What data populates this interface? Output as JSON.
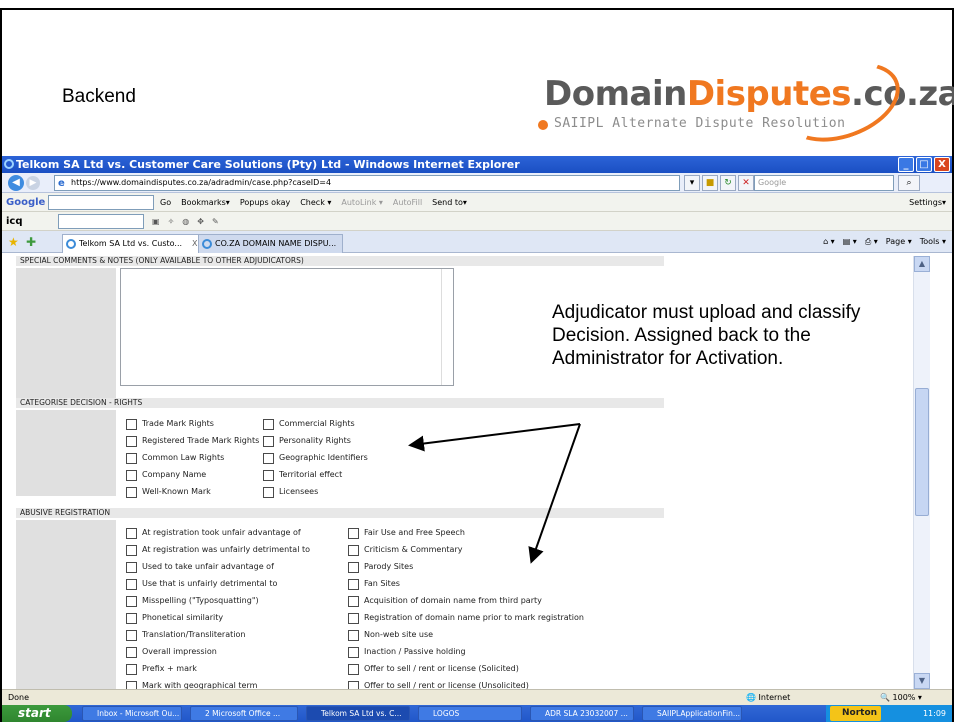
{
  "slide": {
    "title": "Backend",
    "logo": {
      "part1": "Domain",
      "part2": "Disputes",
      "part3": ".co.za",
      "subtitle": "SAIIPL Alternate Dispute Resolution"
    }
  },
  "window": {
    "title": "Telkom SA Ltd vs. Customer Care Solutions (Pty) Ltd - Windows Internet Explorer",
    "buttons": {
      "minimize": "_",
      "maximize": "□",
      "close": "X"
    }
  },
  "addressbar": {
    "url": "https://www.domaindisputes.co.za/adradmin/case.php?caseID=4",
    "search_placeholder": "Google"
  },
  "google_toolbar": {
    "label": "Google",
    "items": [
      "Go",
      "Bookmarks▾",
      "Popups okay",
      "Check ▾",
      "AutoLink ▾",
      "AutoFill",
      "Send to▾"
    ],
    "settings": "Settings▾"
  },
  "icq_toolbar": {
    "label": "icq"
  },
  "tabs": [
    {
      "label": "Telkom SA Ltd vs. Custo...",
      "close": "X",
      "active": true
    },
    {
      "label": "CO.ZA DOMAIN NAME DISPU...",
      "active": false
    }
  ],
  "tab_tools": {
    "page": "Page ▾",
    "tools": "Tools ▾"
  },
  "form": {
    "comments_header": "SPECIAL COMMENTS & NOTES (ONLY AVAILABLE TO OTHER ADJUDICATORS)",
    "rights_header": "CATEGORISE DECISION - RIGHTS",
    "rights_col1": [
      "Trade Mark Rights",
      "Registered Trade Mark Rights",
      "Common Law Rights",
      "Company Name",
      "Well-Known Mark"
    ],
    "rights_col2": [
      "Commercial Rights",
      "Personality Rights",
      "Geographic Identifiers",
      "Territorial effect",
      "Licensees"
    ],
    "abusive_header": "ABUSIVE REGISTRATION",
    "abusive_col1": [
      "At registration took unfair advantage of",
      "At registration was unfairly detrimental to",
      "Used to take unfair advantage of",
      "Use that is unfairly detrimental to",
      "Misspelling (\"Typosquatting\")",
      "Phonetical similarity",
      "Translation/Transliteration",
      "Overall impression",
      "Prefix + mark",
      "Mark with geographical term"
    ],
    "abusive_col2": [
      "Fair Use and Free Speech",
      "Criticism & Commentary",
      "Parody Sites",
      "Fan Sites",
      "Acquisition of domain name from third party",
      "Registration of domain name prior to mark registration",
      "Non-web site use",
      "Inaction / Passive holding",
      "Offer to sell / rent or license (Solicited)",
      "Offer to sell / rent or license (Unsolicited)"
    ]
  },
  "annotation": "Adjudicator must upload and classify Decision. Assigned back to the Administrator for Activation.",
  "statusbar": {
    "status": "Done",
    "zone": "Internet",
    "zoom": "100%"
  },
  "taskbar": {
    "start": "start",
    "tasks": [
      "Inbox - Microsoft Ou...",
      "2 Microsoft Office ...",
      "Telkom SA Ltd vs. C...",
      "LOGOS",
      "ADR SLA 23032007 ...",
      "SAIIPLApplicationFin..."
    ],
    "norton": "Norton",
    "clock": "11:09"
  }
}
